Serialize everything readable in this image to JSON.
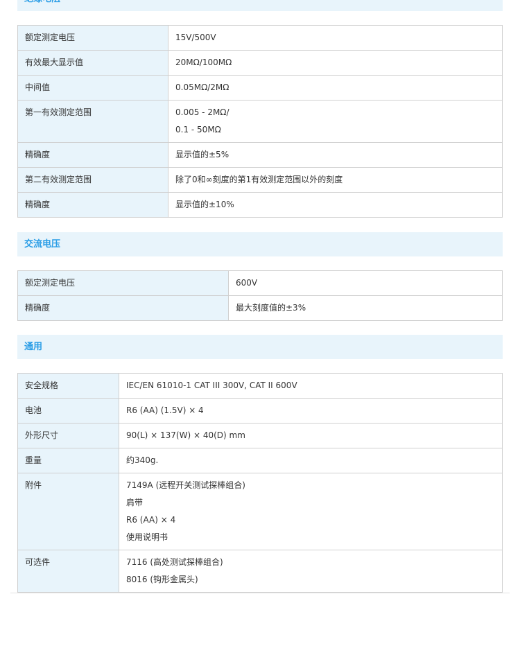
{
  "sections": [
    {
      "title": "绝缘电阻",
      "rows": [
        {
          "label": "额定测定电压",
          "values": [
            "15V/500V"
          ]
        },
        {
          "label": "有效最大显示值",
          "values": [
            "20MΩ/100MΩ"
          ]
        },
        {
          "label": "中间值",
          "values": [
            "0.05MΩ/2MΩ"
          ]
        },
        {
          "label": "第一有效测定范围",
          "values": [
            "0.005 - 2MΩ/",
            "0.1 - 50MΩ"
          ]
        },
        {
          "label": "精确度",
          "values": [
            "显示值的±5%"
          ]
        },
        {
          "label": "第二有效测定范围",
          "values": [
            "除了0和∞刻度的第1有效测定范围以外的刻度"
          ]
        },
        {
          "label": "精确度",
          "values": [
            "显示值的±10%"
          ]
        }
      ]
    },
    {
      "title": "交流电压",
      "rows": [
        {
          "label": "额定测定电压",
          "values": [
            "600V"
          ]
        },
        {
          "label": "精确度",
          "values": [
            "最大刻度值的±3%"
          ]
        }
      ]
    },
    {
      "title": "通用",
      "rows": [
        {
          "label": "安全规格",
          "values": [
            "IEC/EN 61010-1 CAT III 300V, CAT II 600V"
          ]
        },
        {
          "label": "电池",
          "values": [
            "R6 (AA) (1.5V) × 4"
          ]
        },
        {
          "label": "外形尺寸",
          "values": [
            "90(L) × 137(W) × 40(D) mm"
          ]
        },
        {
          "label": "重量",
          "values": [
            "约340g."
          ]
        },
        {
          "label": "附件",
          "values": [
            "7149A (远程开关测试探棒组合)",
            "肩带",
            "R6 (AA) × 4",
            "使用说明书"
          ]
        },
        {
          "label": "可选件",
          "values": [
            "7116 (高处测试探棒组合)",
            "8016 (钩形金属头)"
          ]
        }
      ]
    }
  ]
}
